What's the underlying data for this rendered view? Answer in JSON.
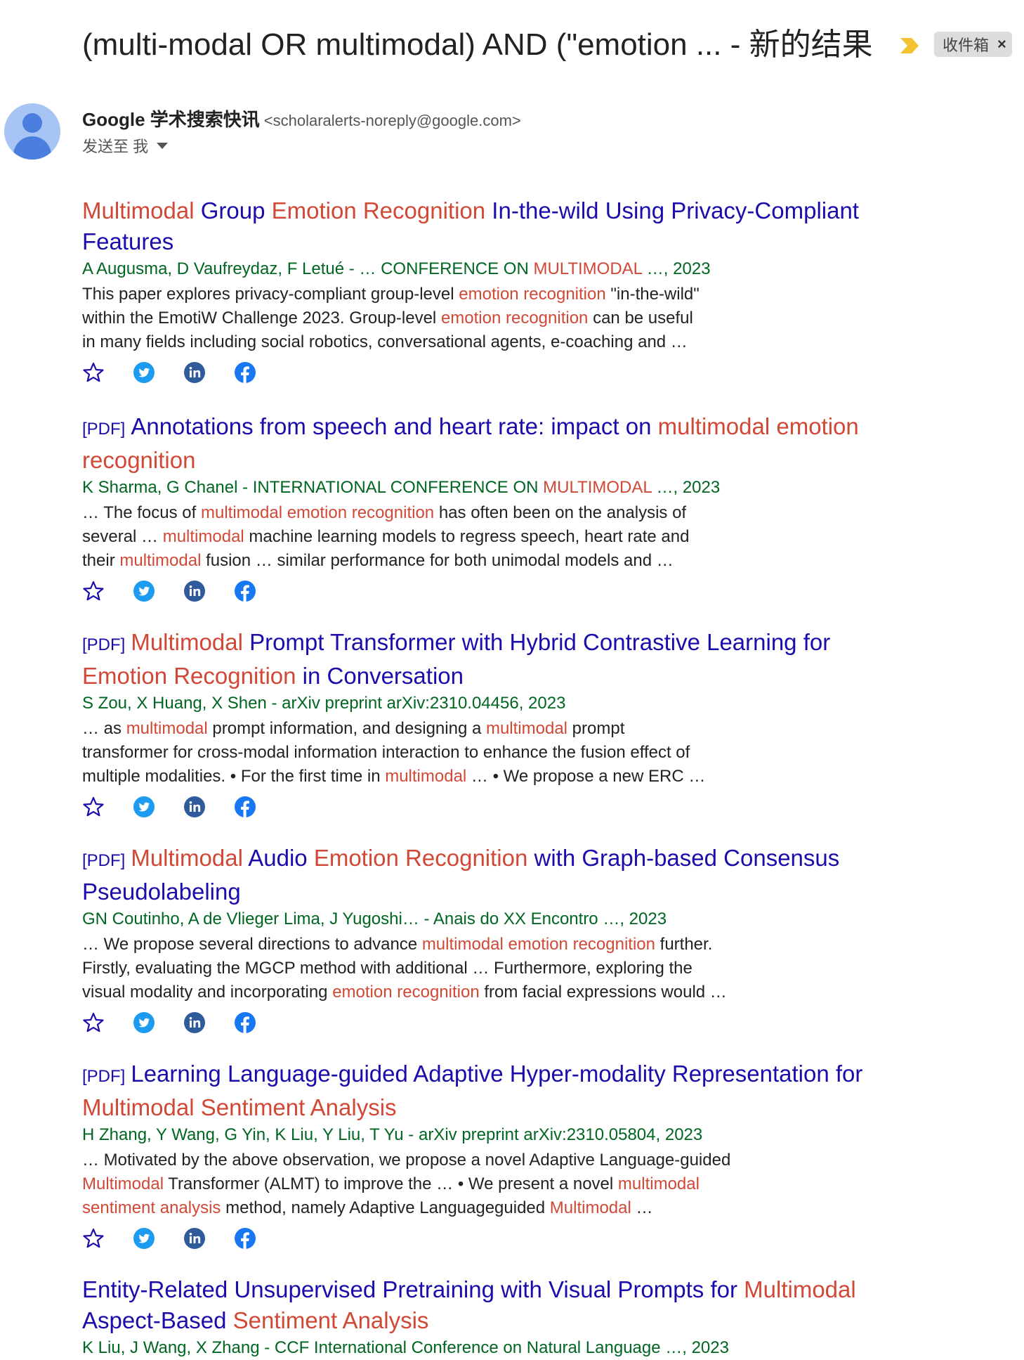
{
  "subject": "(multi-modal OR multimodal) AND (\"emotion ... - 新的结果",
  "label": "收件箱",
  "label_close": "×",
  "sender": {
    "name": "Google 学术搜索快讯",
    "email": "<scholaralerts-noreply@google.com>"
  },
  "recipient": "发送至 我",
  "results": [
    {
      "pdf": "",
      "title_line1": [
        [
          "Multimodal",
          true
        ],
        [
          " Group ",
          false
        ],
        [
          "Emotion Recognition",
          true
        ],
        [
          " In-the-wild Using Privacy-Compliant",
          false
        ]
      ],
      "title_line2": [
        [
          "Features",
          false
        ]
      ],
      "authors": [
        [
          "A Augusma, D Vaufreydaz, F Letué - … CONFERENCE ON ",
          false
        ],
        [
          "MULTIMODAL",
          true
        ],
        [
          " …, 2023",
          false
        ]
      ],
      "snippet": [
        [
          [
            "This paper explores privacy-compliant group-level ",
            false
          ],
          [
            "emotion recognition",
            true
          ],
          [
            " \"in-the-wild\"",
            false
          ]
        ],
        [
          [
            "within the EmotiW Challenge 2023. Group-level ",
            false
          ],
          [
            "emotion recognition",
            true
          ],
          [
            " can be useful",
            false
          ]
        ],
        [
          [
            "in many fields including social robotics, conversational agents, e-coaching and …",
            false
          ]
        ]
      ]
    },
    {
      "pdf": "[PDF]",
      "title_line1": [
        [
          "Annotations from speech and heart rate: impact on ",
          false
        ],
        [
          "multimodal emotion",
          true
        ]
      ],
      "title_line2": [
        [
          "recognition",
          true
        ]
      ],
      "authors": [
        [
          "K Sharma, G Chanel - INTERNATIONAL CONFERENCE ON ",
          false
        ],
        [
          "MULTIMODAL",
          true
        ],
        [
          " …, 2023",
          false
        ]
      ],
      "snippet": [
        [
          [
            "… The focus of ",
            false
          ],
          [
            "multimodal emotion recognition",
            true
          ],
          [
            " has often been on the analysis of",
            false
          ]
        ],
        [
          [
            "several … ",
            false
          ],
          [
            "multimodal",
            true
          ],
          [
            " machine learning models to regress speech, heart rate and",
            false
          ]
        ],
        [
          [
            "their ",
            false
          ],
          [
            "multimodal",
            true
          ],
          [
            " fusion … similar performance for both unimodal models and …",
            false
          ]
        ]
      ]
    },
    {
      "pdf": "[PDF]",
      "title_line1": [
        [
          "Multimodal",
          true
        ],
        [
          " Prompt Transformer with Hybrid Contrastive Learning for",
          false
        ]
      ],
      "title_line2": [
        [
          "Emotion Recognition",
          true
        ],
        [
          " in Conversation",
          false
        ]
      ],
      "authors": [
        [
          "S Zou, X Huang, X Shen - arXiv preprint arXiv:2310.04456, 2023",
          false
        ]
      ],
      "snippet": [
        [
          [
            "… as ",
            false
          ],
          [
            "multimodal",
            true
          ],
          [
            " prompt information, and designing a ",
            false
          ],
          [
            "multimodal",
            true
          ],
          [
            " prompt",
            false
          ]
        ],
        [
          [
            "transformer for cross-modal information interaction to enhance the fusion effect of",
            false
          ]
        ],
        [
          [
            "multiple modalities. • For the first time in ",
            false
          ],
          [
            "multimodal",
            true
          ],
          [
            " … • We propose a new ERC …",
            false
          ]
        ]
      ]
    },
    {
      "pdf": "[PDF]",
      "title_line1": [
        [
          "Multimodal",
          true
        ],
        [
          " Audio ",
          false
        ],
        [
          "Emotion Recognition",
          true
        ],
        [
          " with Graph-based Consensus",
          false
        ]
      ],
      "title_line2": [
        [
          "Pseudolabeling",
          false
        ]
      ],
      "authors": [
        [
          "GN Coutinho, A de Vlieger Lima, J Yugoshi… - Anais do XX Encontro …, 2023",
          false
        ]
      ],
      "snippet": [
        [
          [
            "… We propose several directions to advance ",
            false
          ],
          [
            "multimodal emotion recognition",
            true
          ],
          [
            " further.",
            false
          ]
        ],
        [
          [
            "Firstly, evaluating the MGCP method with additional … Furthermore, exploring the",
            false
          ]
        ],
        [
          [
            "visual modality and incorporating ",
            false
          ],
          [
            "emotion recognition",
            true
          ],
          [
            " from facial expressions would …",
            false
          ]
        ]
      ]
    },
    {
      "pdf": "[PDF]",
      "title_line1": [
        [
          "Learning Language-guided Adaptive Hyper-modality Representation for",
          false
        ]
      ],
      "title_line2": [
        [
          "Multimodal Sentiment Analysis",
          true
        ]
      ],
      "authors": [
        [
          "H Zhang, Y Wang, G Yin, K Liu, Y Liu, T Yu - arXiv preprint arXiv:2310.05804, 2023",
          false
        ]
      ],
      "snippet": [
        [
          [
            "… Motivated by the above observation, we propose a novel Adaptive Language-guided",
            false
          ]
        ],
        [
          [
            "Multimodal",
            true
          ],
          [
            " Transformer (ALMT) to improve the … • We present a novel ",
            false
          ],
          [
            "multimodal",
            true
          ]
        ],
        [
          [
            "sentiment analysis",
            true
          ],
          [
            " method, namely Adaptive Languageguided ",
            false
          ],
          [
            "Multimodal",
            true
          ],
          [
            " …",
            false
          ]
        ]
      ]
    },
    {
      "pdf": "",
      "title_line1": [
        [
          "Entity-Related Unsupervised Pretraining with Visual Prompts for ",
          false
        ],
        [
          "Multimodal",
          true
        ]
      ],
      "title_line2": [
        [
          "Aspect-Based ",
          false
        ],
        [
          "Sentiment Analysis",
          true
        ]
      ],
      "authors": [
        [
          "K Liu, J Wang, X Zhang - CCF International Conference on Natural Language …, 2023",
          false
        ]
      ],
      "snippet": []
    }
  ],
  "icons": [
    "star-icon",
    "twitter-icon",
    "linkedin-icon",
    "facebook-icon"
  ],
  "colors": {
    "link": "#1a0dab",
    "highlight": "#d14836",
    "authors": "#006621",
    "importance": "#f2c230"
  }
}
